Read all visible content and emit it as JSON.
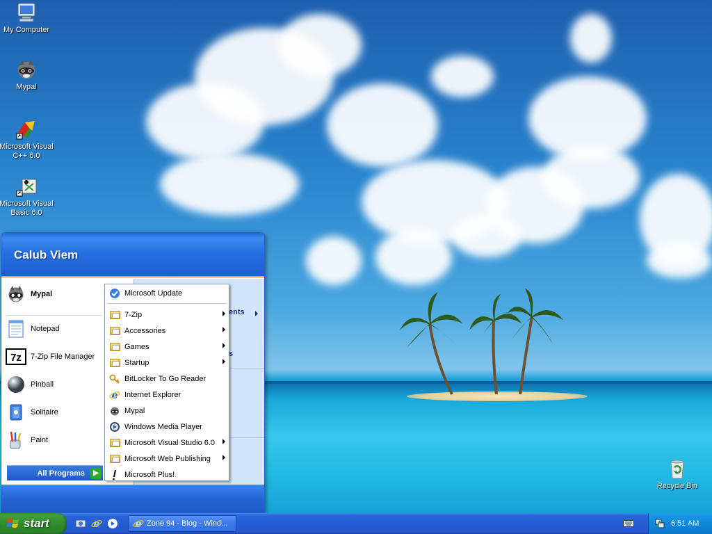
{
  "desktop": {
    "icons": [
      {
        "label": "My Computer"
      },
      {
        "label": "Mypal"
      },
      {
        "label": "Microsoft Visual C++ 6.0"
      },
      {
        "label": "Microsoft Visual Basic 6.0"
      },
      {
        "label": "Recycle Bin"
      }
    ]
  },
  "start_menu": {
    "user_name": "Calub Viem",
    "pinned": [
      {
        "label": "Mypal"
      }
    ],
    "recent": [
      {
        "label": "Notepad"
      },
      {
        "label": "7-Zip File Manager"
      },
      {
        "label": "Pinball"
      },
      {
        "label": "Solitaire"
      },
      {
        "label": "Paint"
      }
    ],
    "all_programs_label": "All Programs",
    "right_fragments": [
      "ents",
      "s"
    ]
  },
  "programs_menu": {
    "top_item": "Microsoft Update",
    "items": [
      {
        "label": "7-Zip",
        "submenu": true
      },
      {
        "label": "Accessories",
        "submenu": true
      },
      {
        "label": "Games",
        "submenu": true
      },
      {
        "label": "Startup",
        "submenu": true
      },
      {
        "label": "BitLocker To Go Reader",
        "submenu": false
      },
      {
        "label": "Internet Explorer",
        "submenu": false
      },
      {
        "label": "Mypal",
        "submenu": false
      },
      {
        "label": "Windows Media Player",
        "submenu": false
      },
      {
        "label": "Microsoft Visual Studio 6.0",
        "submenu": true
      },
      {
        "label": "Microsoft Web Publishing",
        "submenu": true
      },
      {
        "label": "Microsoft Plus!",
        "submenu": false
      }
    ]
  },
  "taskbar": {
    "start_label": "start",
    "task_label": "Zone 94 - Blog - Wind...",
    "clock": "6:51 AM"
  },
  "colors": {
    "taskbar_blue": "#245dd5",
    "start_green": "#2e8a2c",
    "tray_blue": "#0f87dc",
    "menu_accent_orange": "#f59a34"
  }
}
